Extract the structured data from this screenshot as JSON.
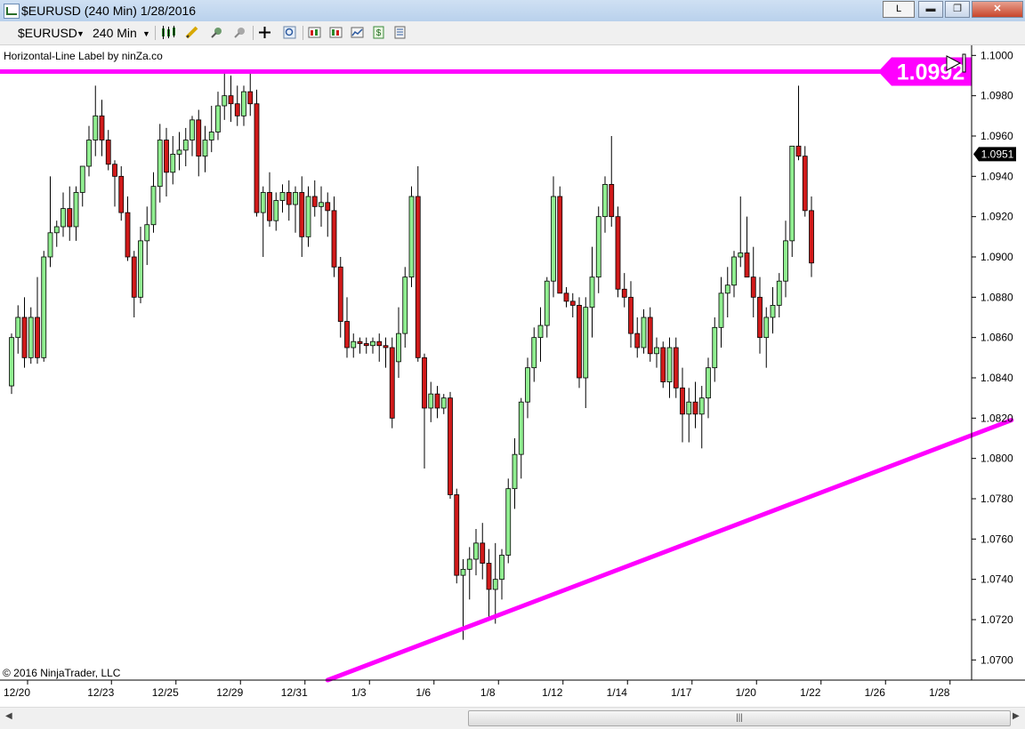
{
  "window": {
    "title": "$EURUSD (240 Min)  1/28/2016",
    "link_label": "L",
    "minimize_label": "▬",
    "maximize_label": "❐",
    "close_label": "✕"
  },
  "toolbar": {
    "instrument": "$EURUSD",
    "interval": "240 Min",
    "icons": [
      "candlestick-style-icon",
      "pencil-icon",
      "magnet-icon",
      "pin-icon",
      "crosshair-icon",
      "zoom-icon",
      "strategies-icon",
      "indicators-icon",
      "chart-properties-icon",
      "money-icon",
      "data-box-icon"
    ]
  },
  "indicator_label": "Horizontal-Line Label by ninZa.co",
  "copyright": "© 2016 NinjaTrader, LLC",
  "colors": {
    "up_candle": "#90ee90",
    "down_candle": "#d11a1a",
    "wick": "#000000",
    "trend_line": "#ff00ff",
    "price_marker_bg": "#000000",
    "line_label_bg": "#ff00ff"
  },
  "chart_data": {
    "type": "candlestick",
    "symbol": "$EURUSD",
    "interval": "240 Min",
    "date": "1/28/2016",
    "ylim": [
      1.069,
      1.1005
    ],
    "y_ticks": [
      1.07,
      1.072,
      1.074,
      1.076,
      1.078,
      1.08,
      1.082,
      1.084,
      1.086,
      1.088,
      1.09,
      1.092,
      1.094,
      1.096,
      1.098,
      1.1
    ],
    "y_tick_labels": [
      "1.0700",
      "1.0720",
      "1.0740",
      "1.0760",
      "1.0780",
      "1.0800",
      "1.0820",
      "1.0840",
      "1.0860",
      "1.0880",
      "1.0900",
      "1.0920",
      "1.0940",
      "1.0960",
      "1.0980",
      "1.1000"
    ],
    "x_tick_labels": [
      {
        "label": "12/20",
        "bar": 0
      },
      {
        "label": "12/23",
        "bar": 13
      },
      {
        "label": "12/25",
        "bar": 23
      },
      {
        "label": "12/29",
        "bar": 33
      },
      {
        "label": "12/31",
        "bar": 43
      },
      {
        "label": "1/3",
        "bar": 53
      },
      {
        "label": "1/6",
        "bar": 63
      },
      {
        "label": "1/8",
        "bar": 73
      },
      {
        "label": "1/12",
        "bar": 83
      },
      {
        "label": "1/14",
        "bar": 93
      },
      {
        "label": "1/17",
        "bar": 103
      },
      {
        "label": "1/20",
        "bar": 113
      },
      {
        "label": "1/22",
        "bar": 123
      },
      {
        "label": "1/26",
        "bar": 133
      },
      {
        "label": "1/28",
        "bar": 143
      }
    ],
    "candles": [
      [
        1.0836,
        1.0862,
        1.0832,
        1.086
      ],
      [
        1.086,
        1.0876,
        1.0852,
        1.087
      ],
      [
        1.087,
        1.088,
        1.0845,
        1.085
      ],
      [
        1.085,
        1.0875,
        1.0847,
        1.087
      ],
      [
        1.087,
        1.089,
        1.0847,
        1.085
      ],
      [
        1.085,
        1.0903,
        1.0848,
        1.09
      ],
      [
        1.09,
        1.094,
        1.0895,
        1.0912
      ],
      [
        1.0912,
        1.0918,
        1.0905,
        1.0915
      ],
      [
        1.0915,
        1.0932,
        1.091,
        1.0924
      ],
      [
        1.0924,
        1.0935,
        1.0908,
        1.0915
      ],
      [
        1.0915,
        1.0935,
        1.0908,
        1.0932
      ],
      [
        1.0932,
        1.0945,
        1.0925,
        1.0945
      ],
      [
        1.0945,
        1.0965,
        1.094,
        1.0958
      ],
      [
        1.0958,
        1.0985,
        1.095,
        1.097
      ],
      [
        1.097,
        1.0978,
        1.095,
        1.0958
      ],
      [
        1.0958,
        1.0963,
        1.0943,
        1.0946
      ],
      [
        1.0946,
        1.0948,
        1.0925,
        1.094
      ],
      [
        1.094,
        1.0945,
        1.0918,
        1.0922
      ],
      [
        1.0922,
        1.093,
        1.0898,
        1.09
      ],
      [
        1.09,
        1.0903,
        1.087,
        1.088
      ],
      [
        1.088,
        1.0915,
        1.0877,
        1.0908
      ],
      [
        1.0908,
        1.0925,
        1.0896,
        1.0916
      ],
      [
        1.0916,
        1.0942,
        1.0912,
        1.0935
      ],
      [
        1.0935,
        1.0966,
        1.0927,
        1.0958
      ],
      [
        1.0958,
        1.0964,
        1.093,
        1.0942
      ],
      [
        1.0942,
        1.096,
        1.0936,
        1.0951
      ],
      [
        1.0951,
        1.0962,
        1.0943,
        1.0953
      ],
      [
        1.0953,
        1.0964,
        1.0945,
        1.0958
      ],
      [
        1.0958,
        1.097,
        1.095,
        1.0968
      ],
      [
        1.0968,
        1.0973,
        1.094,
        1.095
      ],
      [
        1.095,
        1.0965,
        1.0942,
        1.0958
      ],
      [
        1.0958,
        1.0975,
        1.0952,
        1.0962
      ],
      [
        1.0962,
        1.0982,
        1.0958,
        1.0975
      ],
      [
        1.0975,
        1.0992,
        1.0968,
        1.098
      ],
      [
        1.098,
        1.099,
        1.0967,
        1.0976
      ],
      [
        1.0976,
        1.0985,
        1.0965,
        1.097
      ],
      [
        1.097,
        1.0985,
        1.0965,
        1.0982
      ],
      [
        1.0982,
        1.0992,
        1.097,
        1.0976
      ],
      [
        1.0976,
        1.0983,
        1.092,
        1.0922
      ],
      [
        1.0922,
        1.0935,
        1.09,
        1.0932
      ],
      [
        1.0932,
        1.0942,
        1.0915,
        1.0918
      ],
      [
        1.0918,
        1.0932,
        1.0913,
        1.0928
      ],
      [
        1.0928,
        1.0936,
        1.0922,
        1.0932
      ],
      [
        1.0932,
        1.0938,
        1.0918,
        1.0926
      ],
      [
        1.0926,
        1.0935,
        1.0912,
        1.0932
      ],
      [
        1.0932,
        1.094,
        1.09,
        1.091
      ],
      [
        1.091,
        1.0935,
        1.0905,
        1.093
      ],
      [
        1.093,
        1.0938,
        1.092,
        1.0925
      ],
      [
        1.0925,
        1.0935,
        1.0915,
        1.0927
      ],
      [
        1.0927,
        1.0932,
        1.091,
        1.0923
      ],
      [
        1.0923,
        1.093,
        1.089,
        1.0895
      ],
      [
        1.0895,
        1.09,
        1.086,
        1.0868
      ],
      [
        1.0868,
        1.088,
        1.085,
        1.0855
      ],
      [
        1.0855,
        1.0862,
        1.085,
        1.0858
      ],
      [
        1.0858,
        1.086,
        1.0852,
        1.0857
      ],
      [
        1.0857,
        1.086,
        1.0852,
        1.0856
      ],
      [
        1.0856,
        1.086,
        1.0852,
        1.0858
      ],
      [
        1.0858,
        1.0862,
        1.0848,
        1.0856
      ],
      [
        1.0856,
        1.086,
        1.0845,
        1.0855
      ],
      [
        1.0855,
        1.086,
        1.0815,
        1.082
      ],
      [
        1.0848,
        1.0875,
        1.084,
        1.0862
      ],
      [
        1.0862,
        1.0895,
        1.0855,
        1.089
      ],
      [
        1.089,
        1.0935,
        1.0885,
        1.093
      ],
      [
        1.093,
        1.0945,
        1.0848,
        1.085
      ],
      [
        1.085,
        1.0852,
        1.0795,
        1.0825
      ],
      [
        1.0825,
        1.0838,
        1.0818,
        1.0832
      ],
      [
        1.0832,
        1.0836,
        1.082,
        1.0825
      ],
      [
        1.0825,
        1.0832,
        1.0822,
        1.083
      ],
      [
        1.083,
        1.0833,
        1.078,
        1.0782
      ],
      [
        1.0782,
        1.0785,
        1.0738,
        1.0742
      ],
      [
        1.0742,
        1.075,
        1.071,
        1.0745
      ],
      [
        1.0745,
        1.0756,
        1.073,
        1.075
      ],
      [
        1.075,
        1.0765,
        1.0742,
        1.0758
      ],
      [
        1.0758,
        1.0768,
        1.074,
        1.0748
      ],
      [
        1.0748,
        1.0755,
        1.072,
        1.0735
      ],
      [
        1.0735,
        1.0758,
        1.0718,
        1.074
      ],
      [
        1.074,
        1.0755,
        1.073,
        1.0752
      ],
      [
        1.0752,
        1.079,
        1.0748,
        1.0785
      ],
      [
        1.0785,
        1.081,
        1.0775,
        1.0802
      ],
      [
        1.0802,
        1.083,
        1.079,
        1.0828
      ],
      [
        1.0828,
        1.085,
        1.082,
        1.0845
      ],
      [
        1.0845,
        1.0865,
        1.0838,
        1.086
      ],
      [
        1.086,
        1.0875,
        1.0848,
        1.0866
      ],
      [
        1.0866,
        1.089,
        1.086,
        1.0888
      ],
      [
        1.0888,
        1.094,
        1.088,
        1.093
      ],
      [
        1.093,
        1.0935,
        1.089,
        1.0882
      ],
      [
        1.0882,
        1.0885,
        1.0875,
        1.0878
      ],
      [
        1.0878,
        1.0882,
        1.087,
        1.0876
      ],
      [
        1.0876,
        1.088,
        1.0835,
        1.084
      ],
      [
        1.084,
        1.088,
        1.0825,
        1.0875
      ],
      [
        1.0875,
        1.0905,
        1.086,
        1.089
      ],
      [
        1.089,
        1.0925,
        1.0882,
        1.092
      ],
      [
        1.092,
        1.094,
        1.0912,
        1.0936
      ],
      [
        1.0936,
        1.096,
        1.0915,
        1.092
      ],
      [
        1.092,
        1.0925,
        1.088,
        1.0884
      ],
      [
        1.0884,
        1.0892,
        1.0875,
        1.088
      ],
      [
        1.088,
        1.0888,
        1.0855,
        1.0862
      ],
      [
        1.0862,
        1.087,
        1.085,
        1.0855
      ],
      [
        1.0855,
        1.0874,
        1.0852,
        1.087
      ],
      [
        1.087,
        1.0875,
        1.0848,
        1.0852
      ],
      [
        1.0852,
        1.086,
        1.0845,
        1.0855
      ],
      [
        1.0855,
        1.0858,
        1.0835,
        1.0838
      ],
      [
        1.0838,
        1.086,
        1.083,
        1.0855
      ],
      [
        1.0855,
        1.086,
        1.083,
        1.0835
      ],
      [
        1.0835,
        1.0845,
        1.0808,
        1.0822
      ],
      [
        1.0822,
        1.0835,
        1.0808,
        1.0828
      ],
      [
        1.0828,
        1.0838,
        1.0815,
        1.0822
      ],
      [
        1.0822,
        1.0836,
        1.0805,
        1.083
      ],
      [
        1.083,
        1.085,
        1.082,
        1.0845
      ],
      [
        1.0845,
        1.087,
        1.0838,
        1.0865
      ],
      [
        1.0865,
        1.089,
        1.0855,
        1.0882
      ],
      [
        1.0882,
        1.0895,
        1.087,
        1.0886
      ],
      [
        1.0886,
        1.0903,
        1.088,
        1.09
      ],
      [
        1.09,
        1.093,
        1.0895,
        1.0902
      ],
      [
        1.0902,
        1.092,
        1.089,
        1.089
      ],
      [
        1.089,
        1.0905,
        1.087,
        1.088
      ],
      [
        1.088,
        1.089,
        1.0852,
        1.086
      ],
      [
        1.086,
        1.0875,
        1.0845,
        1.087
      ],
      [
        1.087,
        1.0885,
        1.0862,
        1.0876
      ],
      [
        1.0876,
        1.0892,
        1.087,
        1.0888
      ],
      [
        1.0888,
        1.0918,
        1.088,
        1.0908
      ],
      [
        1.0908,
        1.095,
        1.09,
        1.0955
      ],
      [
        1.0955,
        1.0985,
        1.0948,
        1.095
      ],
      [
        1.095,
        1.0955,
        1.092,
        1.0923
      ],
      [
        1.0923,
        1.093,
        1.089,
        1.0897
      ]
    ],
    "horizontal_line": {
      "price": 1.0992,
      "label": "1.0992"
    },
    "trend_line": {
      "from": {
        "bar": 49,
        "price": 1.069
      },
      "to": {
        "bar": 155,
        "price": 1.0819
      }
    },
    "last_price_label": "1.0951",
    "last_price": 1.0951
  }
}
